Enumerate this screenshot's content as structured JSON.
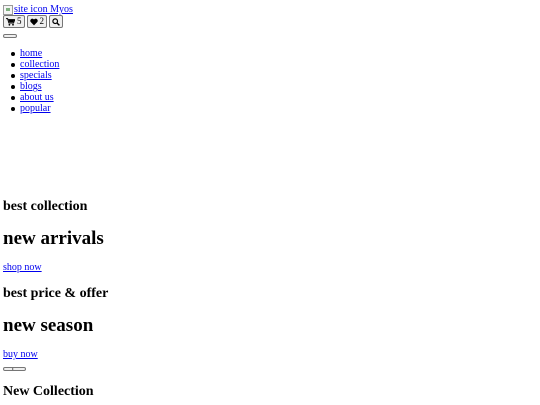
{
  "header": {
    "logo_alt": "site icon",
    "brand_name": "Myos",
    "cart_count": "5",
    "wishlist_count": "2",
    "icons": {
      "cart": "shopping-cart-icon",
      "wishlist": "heart-icon",
      "search": "search-icon"
    }
  },
  "nav": {
    "items": [
      {
        "label": "home"
      },
      {
        "label": "collection"
      },
      {
        "label": "specials"
      },
      {
        "label": "blogs"
      },
      {
        "label": "about us"
      },
      {
        "label": "popular"
      }
    ]
  },
  "slides": [
    {
      "subtitle": "best collection",
      "title": "new arrivals",
      "cta": "shop now"
    },
    {
      "subtitle": "best price & offer",
      "title": "new season",
      "cta": "buy now"
    }
  ],
  "section": {
    "title": "New Collection"
  }
}
